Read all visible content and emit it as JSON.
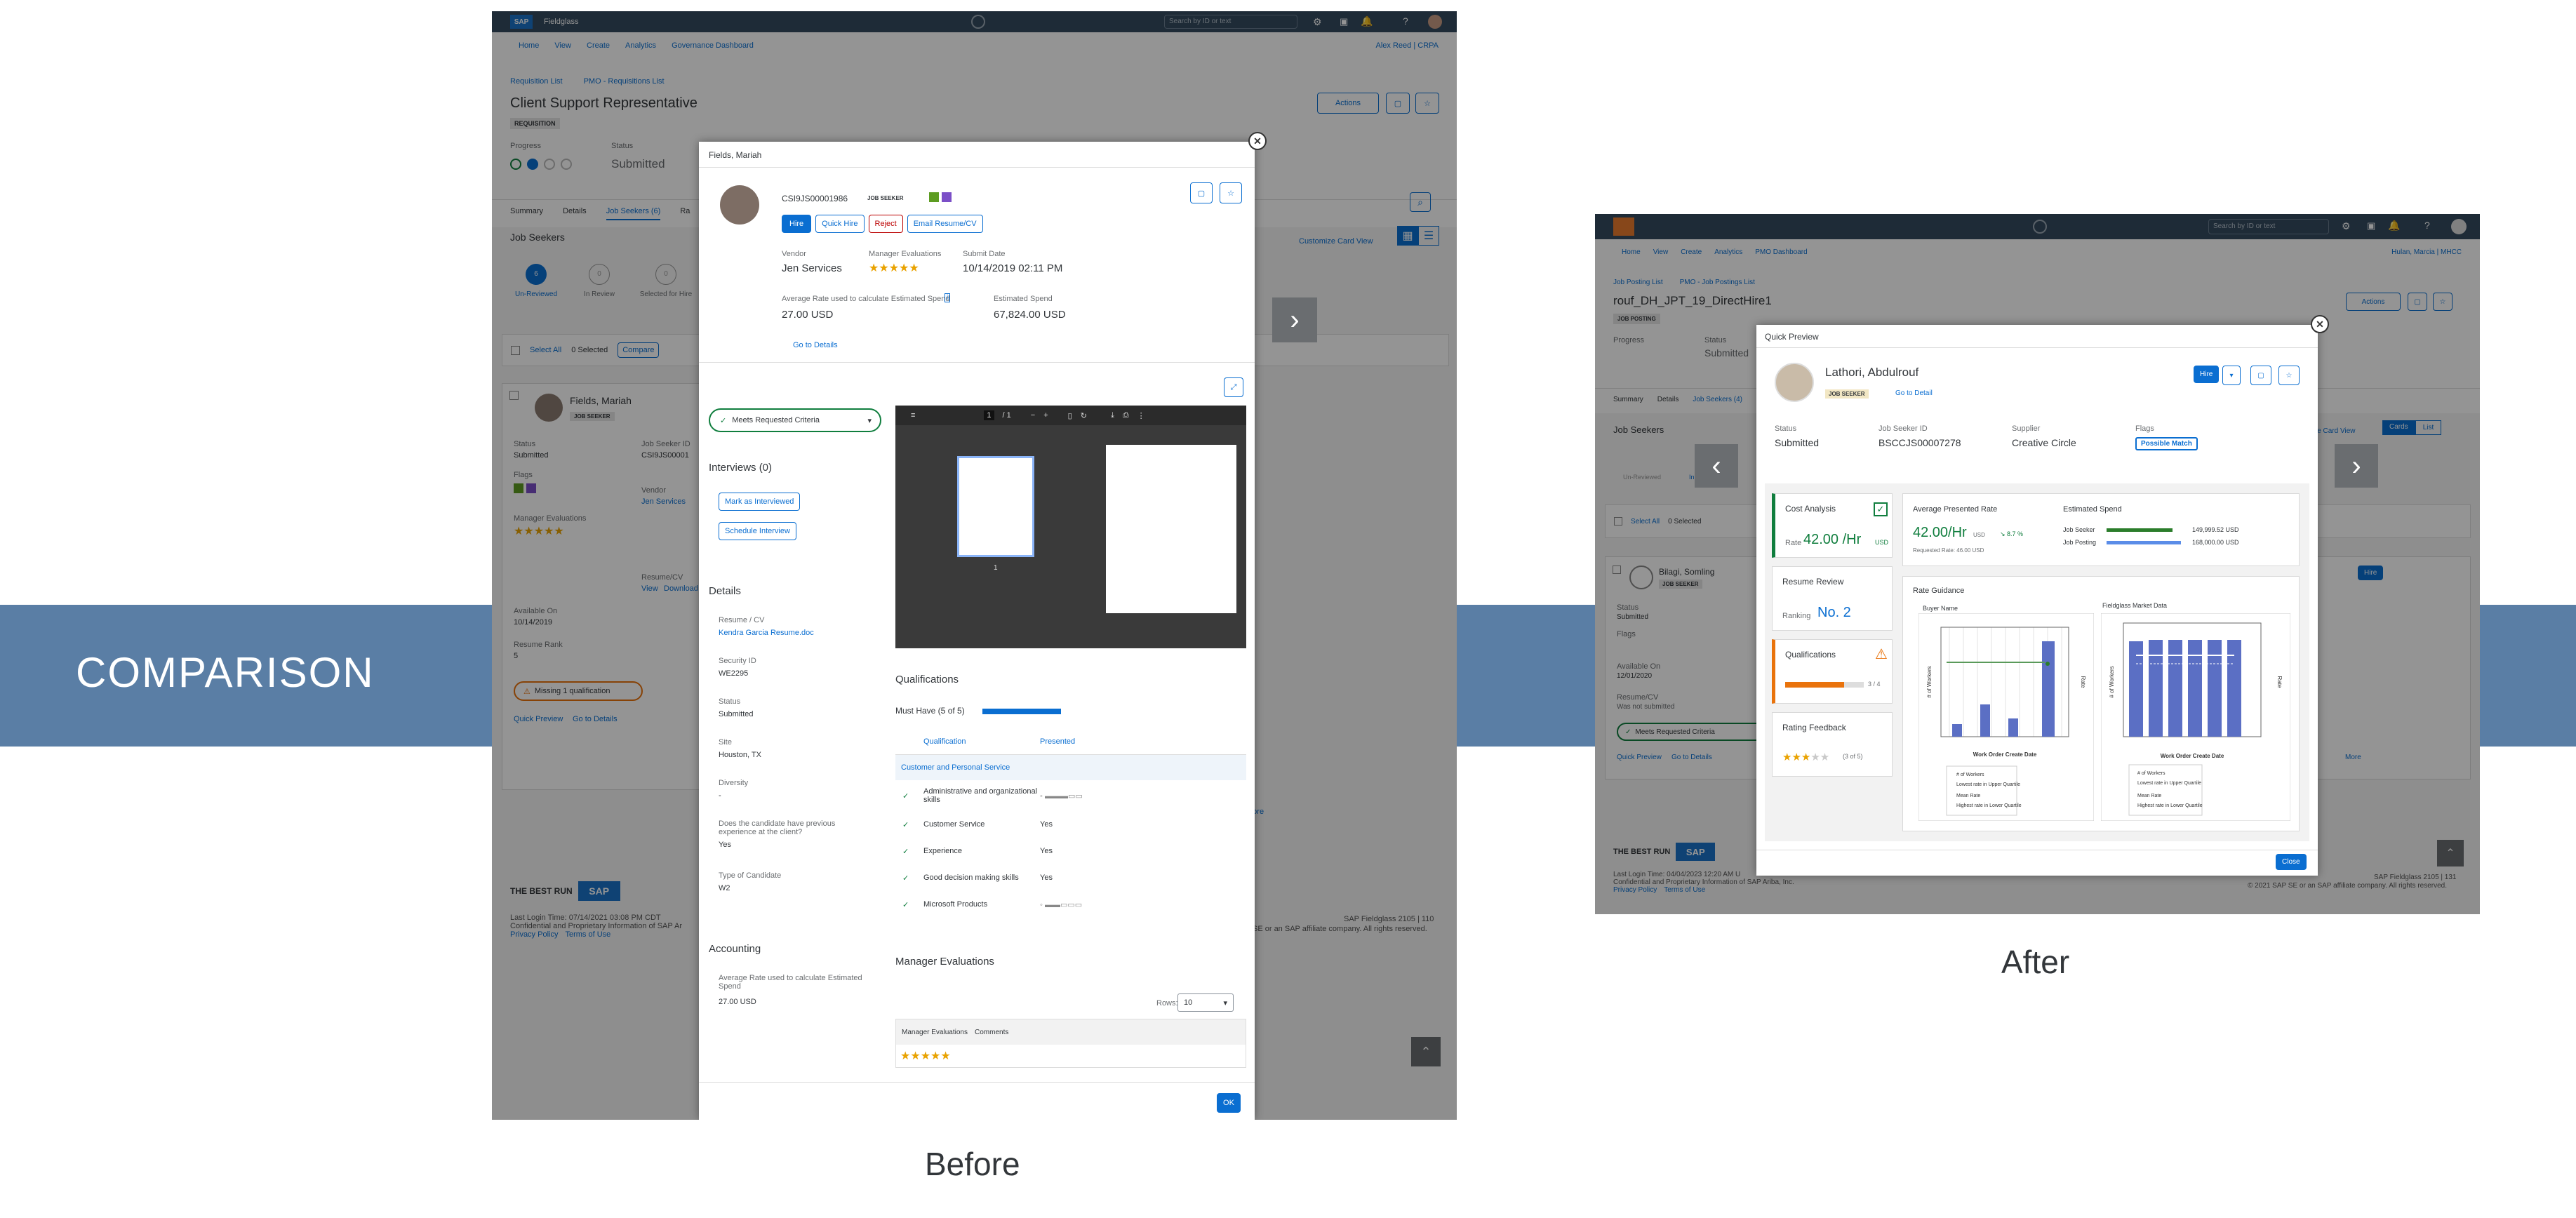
{
  "band": {
    "title": "COMPARISON"
  },
  "captions": {
    "before": "Before",
    "after": "After"
  },
  "before": {
    "shell": {
      "brand": "SAP",
      "product": "Fieldglass",
      "search_placeholder": "Search by ID or text"
    },
    "topnav": [
      "Home",
      "View",
      "Create",
      "Analytics",
      "Governance Dashboard"
    ],
    "user": "Alex Reed | CRPA",
    "breadcrumbs": [
      "Requisition List",
      "PMO - Requisitions List"
    ],
    "title": "Client Support Representative",
    "badge": "REQUISITION",
    "actions_label": "Actions",
    "progress_label": "Progress",
    "status_label": "Status",
    "status_value": "Submitted",
    "tabs": [
      "Summary",
      "Details",
      "Job Seekers (6)",
      "Ra"
    ],
    "job_seekers_title": "Job Seekers",
    "steps": [
      "Un-Reviewed",
      "In Review",
      "Selected for Hire"
    ],
    "step_counts": [
      "6",
      "0",
      "0"
    ],
    "select_all": "Select All",
    "selected": "0 Selected",
    "compare": "Compare",
    "customize_card_view": "Customize Card View",
    "card": {
      "name": "Fields, Mariah",
      "role": "JOB SEEKER",
      "status_label": "Status",
      "status": "Submitted",
      "flags_label": "Flags",
      "manager_eval_label": "Manager Evaluations",
      "available_label": "Available On",
      "available": "10/14/2019",
      "resume_rank_label": "Resume Rank",
      "resume_rank": "5",
      "vendor_label": "Vendor",
      "vendor": "Jen Services",
      "job_seeker_label": "Job Seeker ID",
      "job_seeker": "CSI9JS00001",
      "resume_label": "Resume/CV",
      "view": "View",
      "download": "Download",
      "missing": "Missing 1 qualification",
      "quick_preview": "Quick Preview",
      "go_to_details": "Go to Details",
      "more": "More"
    },
    "footer": {
      "tagline": "THE BEST RUN",
      "login": "Last Login Time: 07/14/2021 03:08 PM CDT",
      "confidential": "Confidential and Proprietary Information of SAP Ar",
      "privacy": "Privacy Policy",
      "terms": "Terms of Use",
      "version": "SAP Fieldglass 2105 | 110",
      "rights": "SE or an SAP affiliate company. All rights reserved."
    },
    "modal": {
      "header": "Fields, Mariah",
      "id": "CSI9JS00001986",
      "badge": "JOB SEEKER",
      "buttons": [
        "Hire",
        "Quick Hire",
        "Reject",
        "Email Resume/CV"
      ],
      "vendor_label": "Vendor",
      "vendor": "Jen Services",
      "mgr_eval_label": "Manager Evaluations",
      "submit_label": "Submit Date",
      "submit": "10/14/2019 02:11 PM",
      "avg_rate_label": "Average Rate used to calculate Estimated Spend",
      "avg_rate": "27.00 USD",
      "est_spend_label": "Estimated Spend",
      "est_spend": "67,824.00 USD",
      "go_to_details": "Go to Details",
      "meets": "Meets Requested Criteria",
      "interviews": "Interviews (0)",
      "mark_interviewed": "Mark as Interviewed",
      "schedule": "Schedule Interview",
      "details_title": "Details",
      "details": [
        {
          "label": "Resume / CV",
          "value": "Kendra Garcia Resume.doc"
        },
        {
          "label": "Security ID",
          "value": "WE2295"
        },
        {
          "label": "Status",
          "value": "Submitted"
        },
        {
          "label": "Site",
          "value": "Houston, TX"
        },
        {
          "label": "Diversity",
          "value": "-"
        },
        {
          "label": "Does the candidate have previous experience at the client?",
          "value": "Yes"
        },
        {
          "label": "Type of Candidate",
          "value": "W2"
        }
      ],
      "accounting_title": "Accounting",
      "accounting_label": "Average Rate used to calculate Estimated Spend",
      "accounting_value": "27.00 USD",
      "pdf_page": "1",
      "pdf_total": "/ 1",
      "thumb_page": "1",
      "qual_title": "Qualifications",
      "must_have": "Must Have (5 of 5)",
      "qual_headers": [
        "Qualification",
        "Presented"
      ],
      "qual_group": "Customer and Personal Service",
      "quals": [
        {
          "name": "Administrative and organizational skills",
          "presented": ""
        },
        {
          "name": "Customer Service",
          "presented": "Yes"
        },
        {
          "name": "Experience",
          "presented": "Yes"
        },
        {
          "name": "Good decision making skills",
          "presented": "Yes"
        },
        {
          "name": "Microsoft Products",
          "presented": ""
        }
      ],
      "mgr_title": "Manager Evaluations",
      "rows_label": "Rows:",
      "rows_value": "10",
      "mgr_headers": [
        "Manager Evaluations",
        "Comments"
      ],
      "ok": "OK"
    }
  },
  "after": {
    "shell": {
      "search_placeholder": "Search by ID or text"
    },
    "topnav": [
      "Home",
      "View",
      "Create",
      "Analytics",
      "PMO Dashboard"
    ],
    "user": "Hulan, Marcia | MHCC",
    "breadcrumbs": [
      "Job Posting List",
      "PMO - Job Postings List"
    ],
    "title": "rouf_DH_JPT_19_DirectHire1",
    "badge": "JOB POSTING",
    "actions_label": "Actions",
    "progress_label": "Progress",
    "status_label": "Status",
    "status": "Submitted",
    "tabs": [
      "Summary",
      "Details",
      "Job Seekers (4)"
    ],
    "job_seekers_title": "Job Seekers",
    "steps": [
      "Un-Reviewed",
      "In Re"
    ],
    "cards_btn": "Cards",
    "list_btn": "List",
    "card_view": "ize Card View",
    "select_all": "Select All",
    "selected": "0 Selected",
    "card": {
      "name": "Bilagi, Somling",
      "role": "JOB SEEKER",
      "status_label": "Status",
      "status": "Submitted",
      "flags_label": "Flags",
      "available_label": "Available On",
      "available": "12/01/2020",
      "resume_label": "Resume/CV",
      "resume": "Was not submitted",
      "meets": "Meets Requested Criteria",
      "quick_preview": "Quick Preview",
      "go_to_details": "Go to Details",
      "more": "More",
      "hire": "Hire"
    },
    "footer": {
      "tagline": "THE BEST RUN",
      "login": "Last Login Time: 04/04/2023 12:20 AM U",
      "confidential": "Confidential and Proprietary Information of SAP Ariba, Inc.",
      "privacy": "Privacy Policy",
      "terms": "Terms of Use",
      "version": "SAP Fieldglass 2105 | 131",
      "rights": "© 2021 SAP SE or an SAP affiliate company. All rights reserved."
    },
    "modal": {
      "header": "Quick Preview",
      "name": "Lathori, Abdulrouf",
      "badge": "JOB SEEKER",
      "go_to_detail": "Go to Detail",
      "hire": "Hire",
      "fields": [
        {
          "label": "Status",
          "value": "Submitted"
        },
        {
          "label": "Job Seeker ID",
          "value": "BSCCJS00007278"
        },
        {
          "label": "Supplier",
          "value": "Creative Circle"
        },
        {
          "label": "Flags",
          "value": "Possible Match"
        }
      ],
      "cost_title": "Cost Analysis",
      "rate_label": "Rate",
      "rate_value": "42.00 /Hr",
      "rate_unit": "USD",
      "resume_title": "Resume Review",
      "ranking_label": "Ranking",
      "ranking_value": "No. 2",
      "qual_title": "Qualifications",
      "qual_value": "3 / 4",
      "rating_title": "Rating Feedback",
      "rating_value": "(3 of 5)",
      "avg_title": "Average Presented Rate",
      "avg_value": "42.00/Hr",
      "avg_unit": "USD",
      "avg_change": "↘ 8.7 %",
      "requested": "Requested Rate: 46.00 USD",
      "spend_title": "Estimated Spend",
      "spend_rows": [
        {
          "label": "Job Seeker",
          "value": "149,999.52 USD",
          "color": "#2b7d2b",
          "pct": 0.89
        },
        {
          "label": "Job Posting",
          "value": "168,000.00 USD",
          "color": "#5b8de8",
          "pct": 1.0
        }
      ],
      "guidance_title": "Rate Guidance",
      "buyer_name": "Buyer Name",
      "market_title": "Fieldglass Market Data",
      "x_axis": "Work Order Create Date",
      "y_left": "# of Workers",
      "y_right": "Rate",
      "legend1": [
        "# of Workers",
        "Lowest rate in Upper Quartile",
        "Mean Rate",
        "Highest rate in Lower Quartile"
      ],
      "legend2": [
        "# of Workers",
        "Lowest rate in Upper Quartile",
        "Mean Rate",
        "Highest rate in Lower Quartile"
      ],
      "close": "Close"
    }
  }
}
